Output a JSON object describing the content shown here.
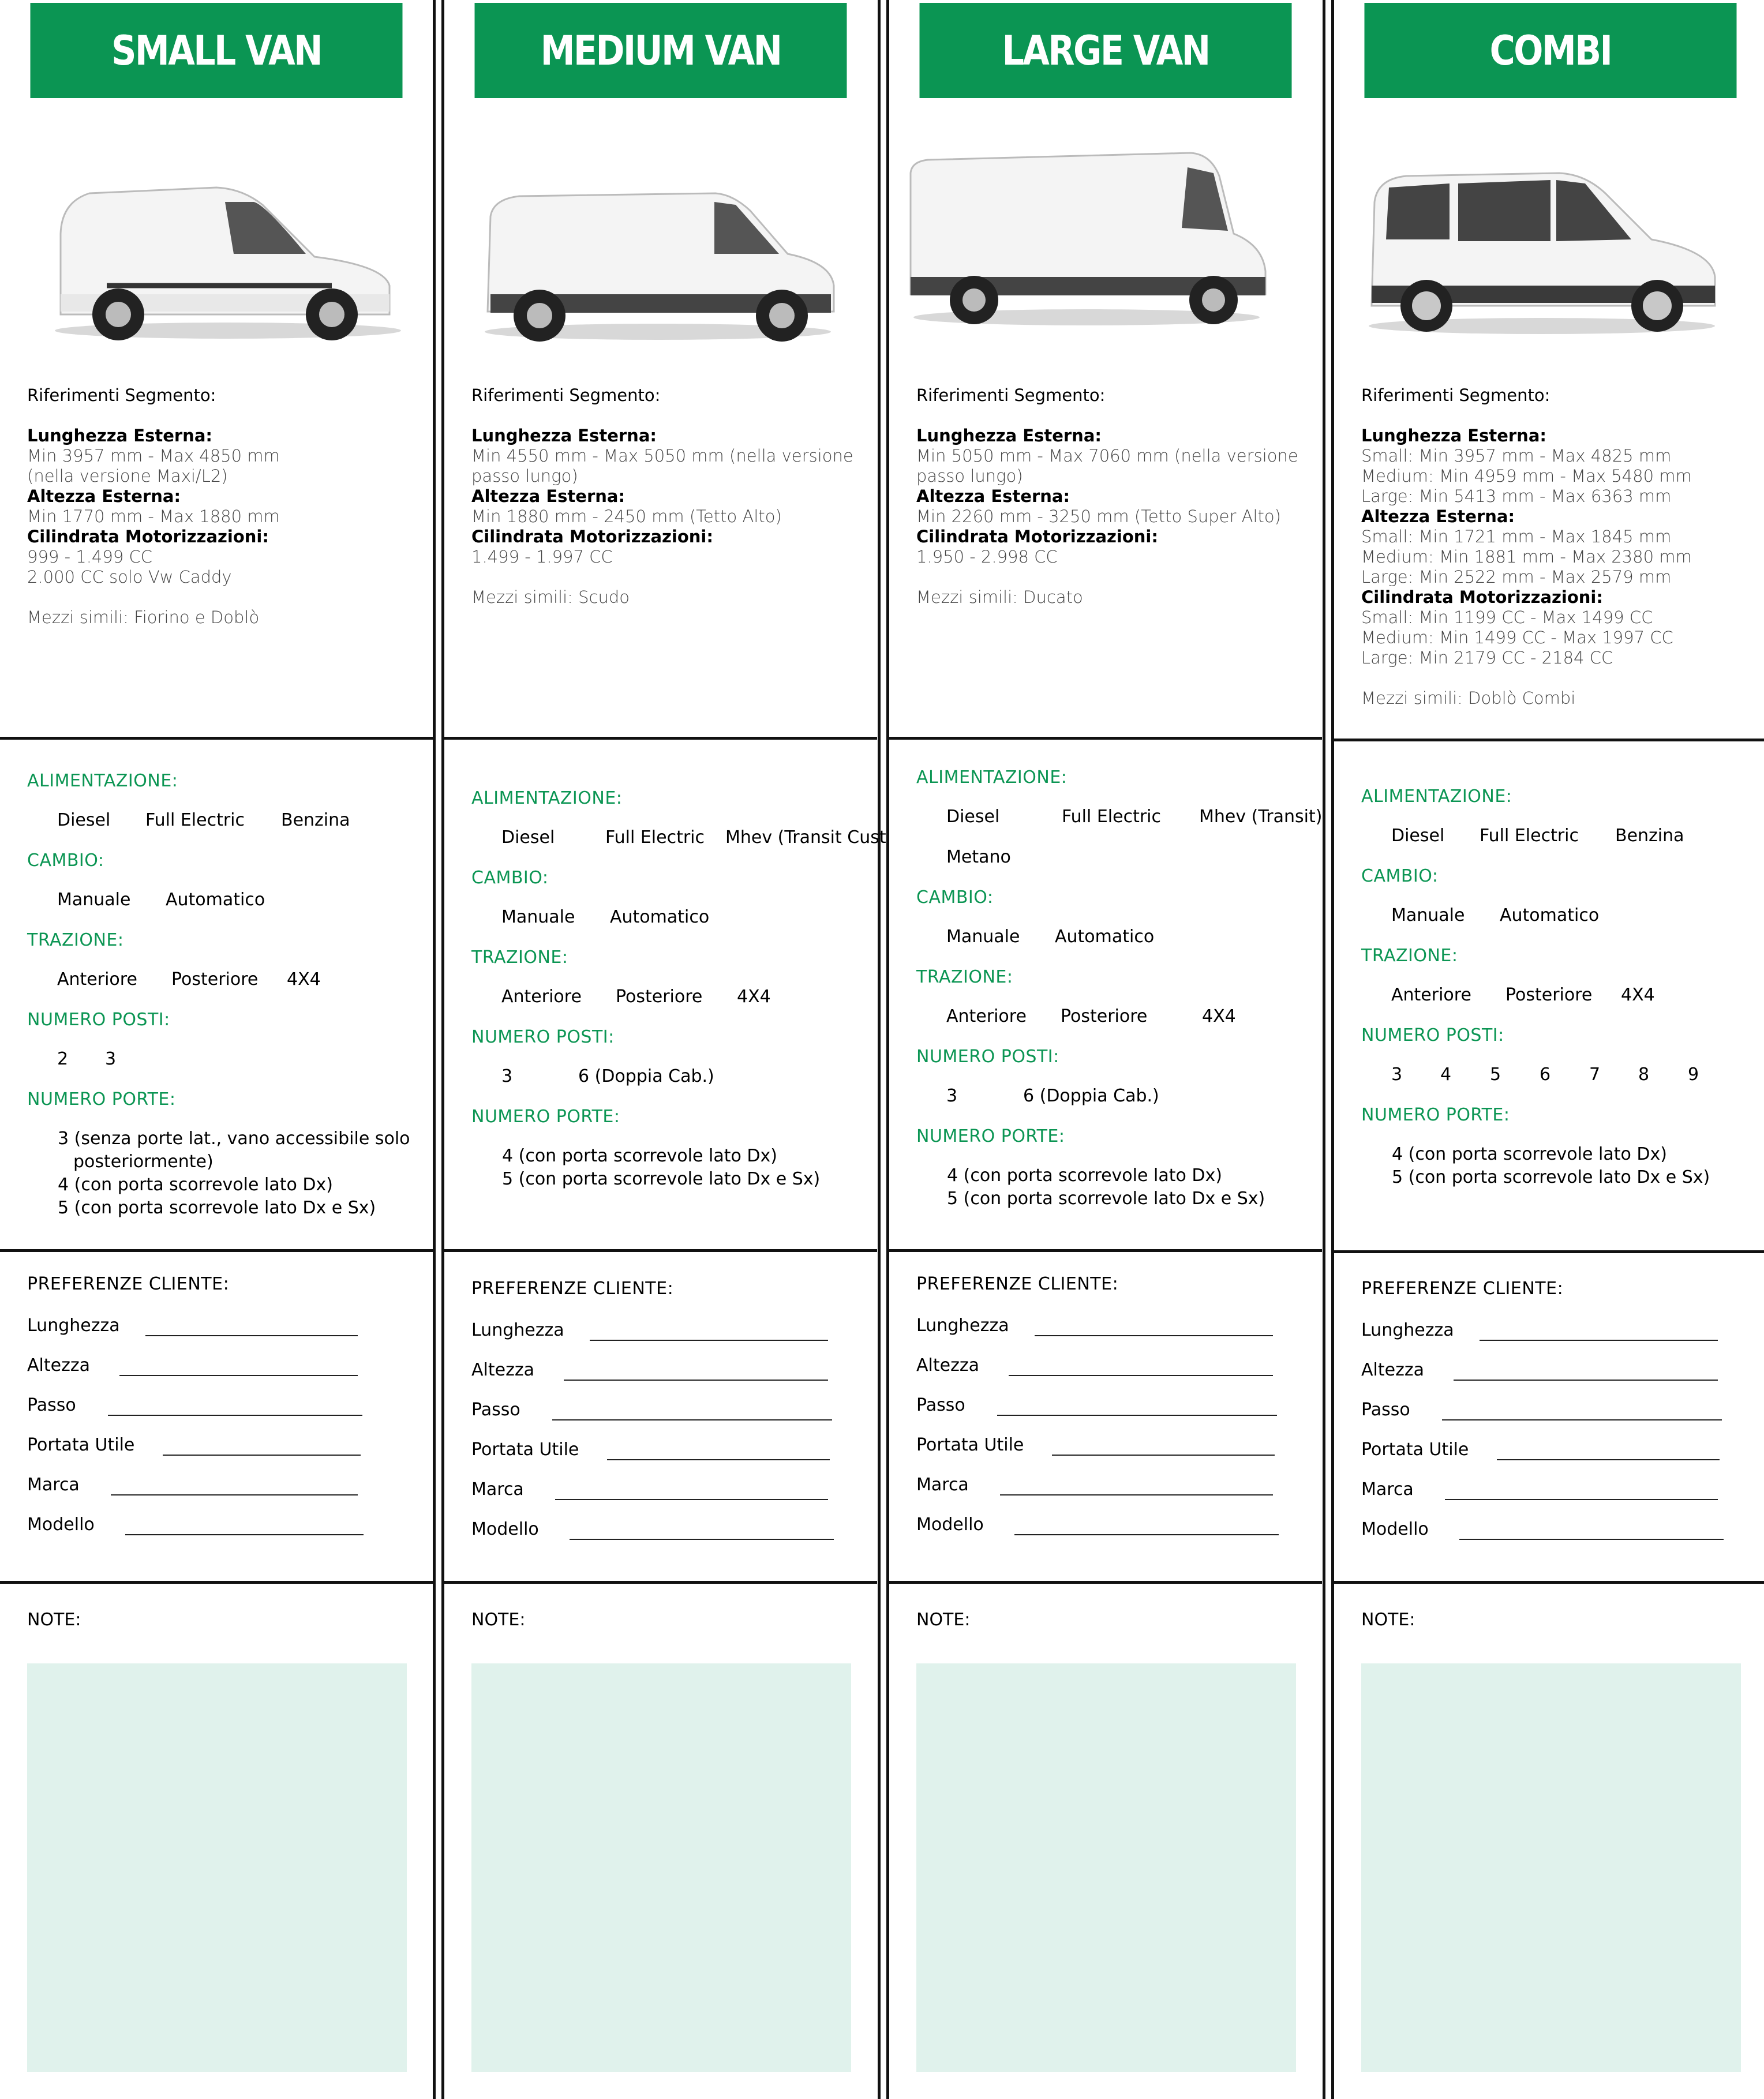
{
  "colors": {
    "accent": "#0b9553",
    "note_bg": "#e0f2ec"
  },
  "columns": [
    {
      "title": "SMALL VAN",
      "image": "van-image",
      "ref_title": "Riferimenti Segmento:",
      "lunghezza_label": "Lunghezza Esterna:",
      "lunghezza": [
        "Min 3957 mm - Max 4850 mm",
        "(nella versione Maxi/L2)"
      ],
      "altezza_label": "Altezza Esterna:",
      "altezza": [
        "Min 1770 mm - Max 1880 mm"
      ],
      "cilindrata_label": "Cilindrata Motorizzazioni:",
      "cilindrata": [
        "999 - 1.499 CC",
        "2.000 CC solo Vw Caddy"
      ],
      "simili": "Mezzi simili: Fiorino e Doblò",
      "alimentazione_label": "ALIMENTAZIONE:",
      "alimentazione": [
        "Diesel",
        "Full Electric",
        "Benzina"
      ],
      "cambio_label": "CAMBIO:",
      "cambio": [
        "Manuale",
        "Automatico"
      ],
      "trazione_label": "TRAZIONE:",
      "trazione": [
        "Anteriore",
        "Posteriore",
        "4X4"
      ],
      "posti_label": "NUMERO POSTI:",
      "posti": [
        "2",
        "3"
      ],
      "porte_label": "NUMERO PORTE:",
      "porte": [
        "3 (senza porte lat., vano accessibile solo",
        "posteriormente)",
        "4 (con porta scorrevole lato Dx)",
        "5 (con porta scorrevole lato Dx e Sx)"
      ],
      "pref_title": "PREFERENZE CLIENTE:",
      "pref": [
        "Lunghezza",
        "Altezza",
        "Passo",
        "Portata Utile",
        "Marca",
        "Modello"
      ],
      "note": "NOTE:"
    },
    {
      "title": "MEDIUM VAN",
      "image": "van-image",
      "ref_title": "Riferimenti Segmento:",
      "lunghezza_label": "Lunghezza Esterna:",
      "lunghezza": [
        "Min 4550 mm - Max 5050 mm (nella versione",
        "passo lungo)"
      ],
      "altezza_label": "Altezza Esterna:",
      "altezza": [
        "Min 1880 mm  - 2450 mm (Tetto Alto)"
      ],
      "cilindrata_label": "Cilindrata Motorizzazioni:",
      "cilindrata": [
        "1.499 - 1.997 CC"
      ],
      "simili": "Mezzi simili: Scudo",
      "alimentazione_label": "ALIMENTAZIONE:",
      "alimentazione": [
        "Diesel",
        "Full Electric",
        "Mhev (Transit Custom)"
      ],
      "cambio_label": "CAMBIO:",
      "cambio": [
        "Manuale",
        "Automatico"
      ],
      "trazione_label": "TRAZIONE:",
      "trazione": [
        "Anteriore",
        "Posteriore",
        "4X4"
      ],
      "posti_label": "NUMERO POSTI:",
      "posti": [
        "3",
        "6 (Doppia Cab.)"
      ],
      "porte_label": "NUMERO PORTE:",
      "porte": [
        "4 (con porta scorrevole lato Dx)",
        "5 (con porta scorrevole lato Dx e Sx)"
      ],
      "pref_title": "PREFERENZE CLIENTE:",
      "pref": [
        "Lunghezza",
        "Altezza",
        "Passo",
        "Portata Utile",
        "Marca",
        "Modello"
      ],
      "note": "NOTE:"
    },
    {
      "title": "LARGE VAN",
      "image": "van-image",
      "ref_title": "Riferimenti Segmento:",
      "lunghezza_label": "Lunghezza Esterna:",
      "lunghezza": [
        "Min 5050 mm - Max 7060 mm (nella versione",
        "passo lungo)"
      ],
      "altezza_label": "Altezza Esterna:",
      "altezza": [
        "Min 2260 mm  - 3250 mm (Tetto Super Alto)"
      ],
      "cilindrata_label": "Cilindrata Motorizzazioni:",
      "cilindrata": [
        "1.950 - 2.998 CC"
      ],
      "simili": "Mezzi simili: Ducato",
      "alimentazione_label": "ALIMENTAZIONE:",
      "alimentazione": [
        "Diesel",
        "Full Electric",
        "Mhev (Transit)",
        "Metano"
      ],
      "cambio_label": "CAMBIO:",
      "cambio": [
        "Manuale",
        "Automatico"
      ],
      "trazione_label": "TRAZIONE:",
      "trazione": [
        "Anteriore",
        "Posteriore",
        "4X4"
      ],
      "posti_label": "NUMERO POSTI:",
      "posti": [
        "3",
        "6 (Doppia Cab.)"
      ],
      "porte_label": "NUMERO PORTE:",
      "porte": [
        "4 (con porta scorrevole lato Dx)",
        "5 (con porta scorrevole lato Dx e Sx)"
      ],
      "pref_title": "PREFERENZE CLIENTE:",
      "pref": [
        "Lunghezza",
        "Altezza",
        "Passo",
        "Portata Utile",
        "Marca",
        "Modello"
      ],
      "note": "NOTE:"
    },
    {
      "title": "COMBI",
      "image": "combi-image",
      "ref_title": "Riferimenti Segmento:",
      "lunghezza_label": "Lunghezza Esterna:",
      "lunghezza": [
        "Small: Min 3957 mm - Max 4825 mm",
        "Medium: Min 4959 mm - Max 5480 mm",
        "Large: Min 5413 mm - Max 6363 mm"
      ],
      "altezza_label": "Altezza Esterna:",
      "altezza": [
        "Small: Min 1721 mm - Max 1845 mm",
        "Medium: Min 1881 mm - Max 2380 mm",
        "Large: Min 2522 mm - Max 2579 mm"
      ],
      "cilindrata_label": "Cilindrata Motorizzazioni:",
      "cilindrata": [
        "Small: Min 1199 CC - Max 1499 CC",
        "Medium: Min 1499 CC - Max 1997 CC",
        "Large: Min 2179 CC - 2184 CC"
      ],
      "simili": "Mezzi simili: Doblò Combi",
      "alimentazione_label": "ALIMENTAZIONE:",
      "alimentazione": [
        "Diesel",
        "Full Electric",
        "Benzina"
      ],
      "cambio_label": "CAMBIO:",
      "cambio": [
        "Manuale",
        "Automatico"
      ],
      "trazione_label": "TRAZIONE:",
      "trazione": [
        "Anteriore",
        "Posteriore",
        "4X4"
      ],
      "posti_label": "NUMERO POSTI:",
      "posti": [
        "3",
        "4",
        "5",
        "6",
        "7",
        "8",
        "9"
      ],
      "porte_label": "NUMERO PORTE:",
      "porte": [
        "4 (con porta scorrevole lato Dx)",
        "5 (con porta scorrevole lato Dx e Sx)"
      ],
      "pref_title": "PREFERENZE CLIENTE:",
      "pref": [
        "Lunghezza",
        "Altezza",
        "Passo",
        "Portata Utile",
        "Marca",
        "Modello"
      ],
      "note": "NOTE:"
    }
  ]
}
